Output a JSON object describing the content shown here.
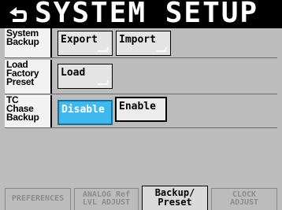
{
  "title": "SYSTEM SETUP",
  "back_icon": "back-arrow-icon",
  "rows": {
    "system_backup": {
      "label": [
        "System",
        "Backup"
      ],
      "export_label": "Export",
      "import_label": "Import"
    },
    "load_factory_preset": {
      "label": [
        "Load",
        "Factory",
        "Preset"
      ],
      "load_label": "Load"
    },
    "tc_chase_backup": {
      "label": [
        "TC",
        "Chase",
        "Backup"
      ],
      "disable_label": "Disable",
      "enable_label": "Enable",
      "selected": "Disable"
    }
  },
  "tabs": [
    {
      "lines": [
        "PREFERENCES"
      ],
      "active": false
    },
    {
      "lines": [
        "ANALOG Ref",
        "LVL ADJUST"
      ],
      "active": false
    },
    {
      "lines": [
        "Backup/",
        "Preset"
      ],
      "active": true
    },
    {
      "lines": [
        "CLOCK",
        "ADJUST"
      ],
      "active": false
    }
  ],
  "colors": {
    "title_bar": "#000000",
    "background": "#bcbcbc",
    "selected_button": "#3fb8ee"
  }
}
